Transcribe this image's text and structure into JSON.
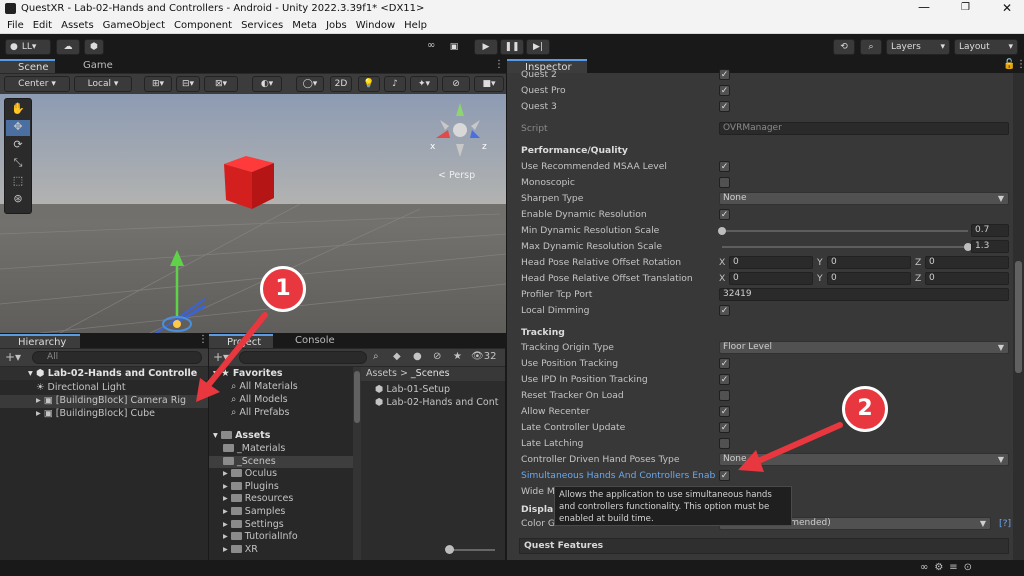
{
  "window": {
    "title": "QuestXR - Lab-02-Hands and Controllers - Android - Unity 2022.3.39f1* <DX11>"
  },
  "menu": [
    "File",
    "Edit",
    "Assets",
    "GameObject",
    "Component",
    "Services",
    "Meta",
    "Jobs",
    "Window",
    "Help"
  ],
  "toolbar": {
    "account": "LL",
    "layers": "Layers",
    "layout": "Layout"
  },
  "scene": {
    "tabs": [
      "Scene",
      "Game"
    ],
    "pivot": "Center",
    "space": "Local",
    "mode2d": "2D",
    "persp": "< Persp",
    "gizmo": {
      "x": "x",
      "z": "z"
    }
  },
  "hierarchy": {
    "tab": "Hierarchy",
    "search_placeholder": "All",
    "scene": "Lab-02-Hands and Controlle",
    "items": [
      "Directional Light",
      "[BuildingBlock] Camera Rig",
      "[BuildingBlock] Cube"
    ]
  },
  "project": {
    "tabs": [
      "Project",
      "Console"
    ],
    "count": "32",
    "favorites": {
      "label": "Favorites",
      "items": [
        "All Materials",
        "All Models",
        "All Prefabs"
      ]
    },
    "assets": {
      "label": "Assets",
      "items": [
        "_Materials",
        "_Scenes",
        "Oculus",
        "Plugins",
        "Resources",
        "Samples",
        "Settings",
        "TutorialInfo",
        "XR"
      ]
    },
    "breadcrumb": [
      "Assets",
      "_Scenes"
    ],
    "files": [
      "Lab-01-Setup",
      "Lab-02-Hands and Cont"
    ]
  },
  "inspector": {
    "tab": "Inspector",
    "top": [
      {
        "label": "Quest 2",
        "checked": true
      },
      {
        "label": "Quest Pro",
        "checked": true
      },
      {
        "label": "Quest 3",
        "checked": true
      }
    ],
    "script_label": "Script",
    "script_value": "OVRManager",
    "perf_header": "Performance/Quality",
    "perf": [
      {
        "label": "Use Recommended MSAA Level",
        "type": "check",
        "checked": true
      },
      {
        "label": "Monoscopic",
        "type": "check",
        "checked": false
      },
      {
        "label": "Sharpen Type",
        "type": "drop",
        "value": "None"
      },
      {
        "label": "Enable Dynamic Resolution",
        "type": "check",
        "checked": true
      },
      {
        "label": "Min Dynamic Resolution Scale",
        "type": "slider",
        "value": "0.7",
        "level": 0
      },
      {
        "label": "Max Dynamic Resolution Scale",
        "type": "slider",
        "value": "1.3",
        "level": 1
      },
      {
        "label": "Head Pose Relative Offset Rotation",
        "type": "vec3",
        "x": "0",
        "y": "0",
        "z": "0"
      },
      {
        "label": "Head Pose Relative Offset Translation",
        "type": "vec3",
        "x": "0",
        "y": "0",
        "z": "0"
      },
      {
        "label": "Profiler Tcp Port",
        "type": "text",
        "value": "32419"
      },
      {
        "label": "Local Dimming",
        "type": "check",
        "checked": true
      }
    ],
    "tracking_header": "Tracking",
    "tracking": [
      {
        "label": "Tracking Origin Type",
        "type": "drop",
        "value": "Floor Level"
      },
      {
        "label": "Use Position Tracking",
        "type": "check",
        "checked": true
      },
      {
        "label": "Use IPD In Position Tracking",
        "type": "check",
        "checked": true
      },
      {
        "label": "Reset Tracker On Load",
        "type": "check",
        "checked": false
      },
      {
        "label": "Allow Recenter",
        "type": "check",
        "checked": true
      },
      {
        "label": "Late Controller Update",
        "type": "check",
        "checked": true
      },
      {
        "label": "Late Latching",
        "type": "check",
        "checked": false
      },
      {
        "label": "Controller Driven Hand Poses Type",
        "type": "drop",
        "value": "None"
      },
      {
        "label": "Simultaneous Hands And Controllers Enab",
        "type": "check",
        "checked": true,
        "highlight": true
      }
    ],
    "wide_label": "Wide M",
    "display_header": "Displa",
    "color_gamut_label": "Color Gamut",
    "color_gamut_value": "DCI-P3 (Recommended)",
    "help": "[?]",
    "quest_features": "Quest Features",
    "tooltip": [
      "Allows the application to use simultaneous hands",
      "and controllers functionality. This option must be",
      "enabled at build time."
    ]
  },
  "annotations": {
    "one": "1",
    "two": "2"
  },
  "colors": {
    "accent": "#5a9be6",
    "annotation_red": "#e8373e"
  }
}
